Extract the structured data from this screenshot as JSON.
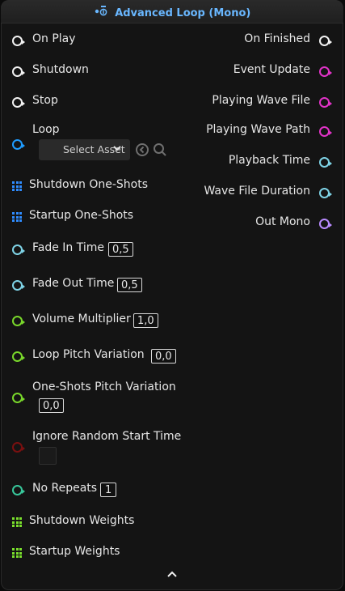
{
  "node": {
    "title": "Advanced Loop (Mono)",
    "header_icon": "audio-node-icon",
    "inputs": {
      "on_play": "On Play",
      "shutdown": "Shutdown",
      "stop": "Stop",
      "loop": "Loop",
      "loop_select_placeholder": "Select Asset",
      "shutdown_one_shots": "Shutdown One-Shots",
      "startup_one_shots": "Startup One-Shots",
      "fade_in_time": "Fade In Time",
      "fade_in_value": "0,5",
      "fade_out_time": "Fade Out Time",
      "fade_out_value": "0,5",
      "volume_multiplier": "Volume Multiplier",
      "volume_multiplier_value": "1,0",
      "loop_pitch_variation": "Loop Pitch Variation",
      "loop_pitch_variation_value": "0,0",
      "one_shots_pitch_variation": "One-Shots Pitch Variation",
      "one_shots_pitch_variation_value": "0,0",
      "ignore_random_start_time": "Ignore Random Start Time",
      "no_repeats": "No Repeats",
      "no_repeats_value": "1",
      "shutdown_weights": "Shutdown Weights",
      "startup_weights": "Startup Weights"
    },
    "outputs": {
      "on_finished": "On Finished",
      "event_update": "Event Update",
      "playing_wave_file": "Playing Wave File",
      "playing_wave_path": "Playing Wave Path",
      "playback_time": "Playback Time",
      "wave_file_duration": "Wave File Duration",
      "out_mono": "Out Mono"
    }
  },
  "colors": {
    "exec": "#f2f2f2",
    "wave_asset_pin": "#e233c8",
    "float_pin": "#7fd3e6",
    "audio_pin": "#b98bff",
    "asset_pin": "#1f9cff",
    "float_green_pin": "#79d72b",
    "int_pin": "#38c79b",
    "bool_pin": "#7a1010",
    "array_pin": "#2f8cff",
    "weights_array_pin": "#7adf2d"
  }
}
